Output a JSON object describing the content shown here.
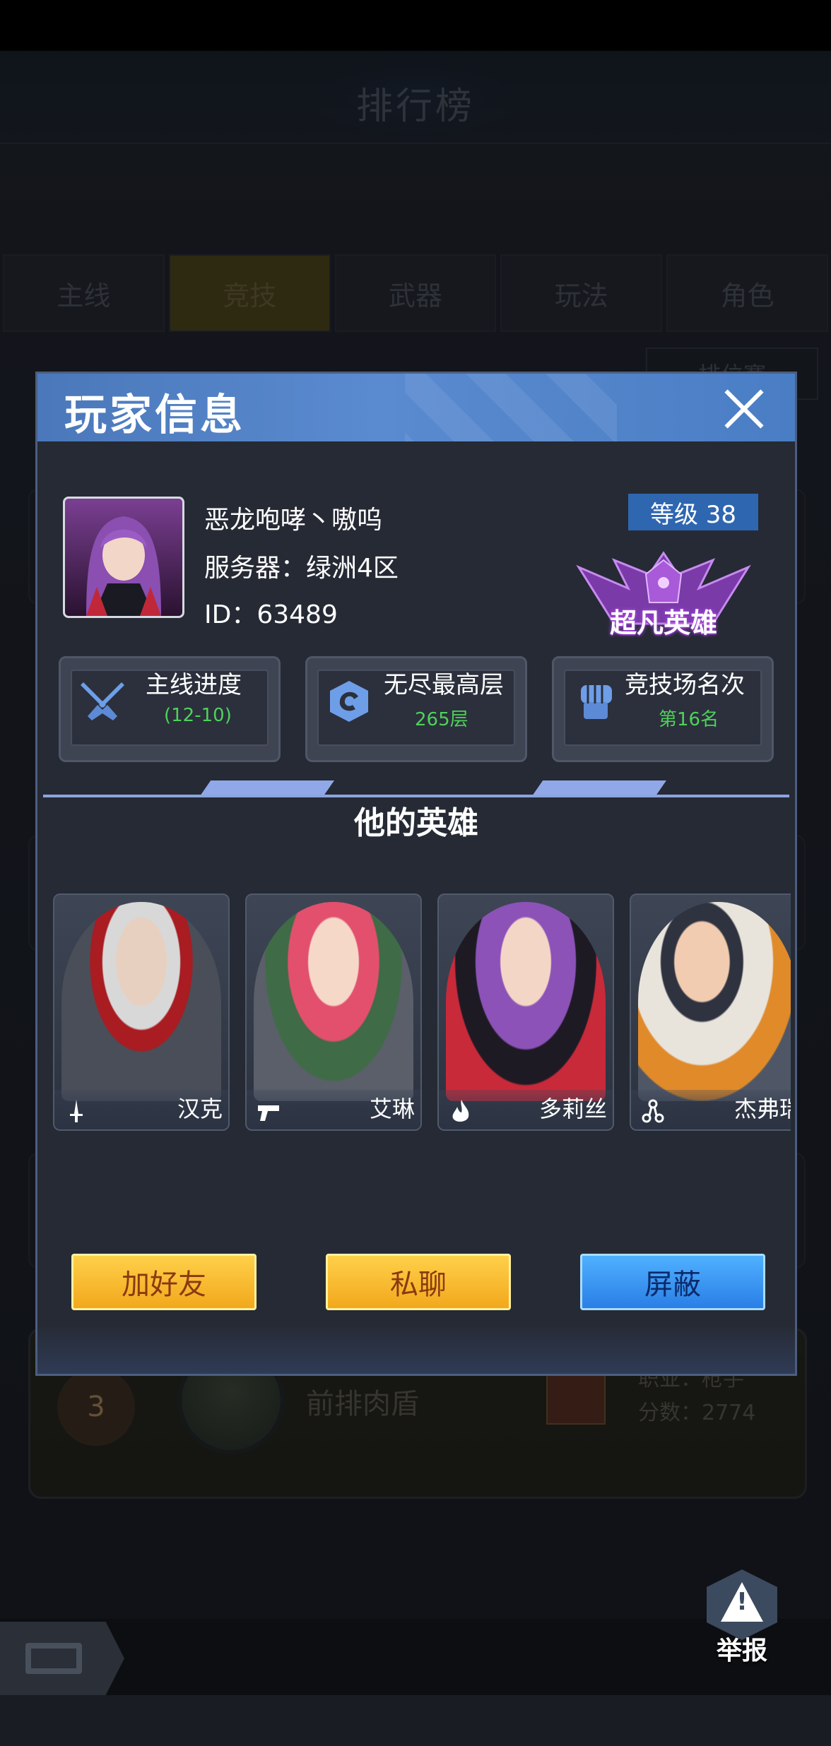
{
  "background": {
    "title": "排行榜",
    "tabs": [
      "主线",
      "竞技",
      "武器",
      "玩法",
      "角色"
    ],
    "active_tab": "竞技",
    "sort_label": "排位赛",
    "row3": {
      "rank": "3",
      "name": "前排肉盾",
      "job": "职业：枪手",
      "score": "分数：2774"
    },
    "report_label": "举报"
  },
  "dialog": {
    "title": "玩家信息",
    "player_name": "恶龙咆哮丶嗷呜",
    "server": "服务器：绿洲4区",
    "id": "ID：63489",
    "level": "等级 38",
    "rank_title": "超凡英雄",
    "stats": [
      {
        "label": "主线进度",
        "value": "(12-10)",
        "icon": "crossed-swords-icon"
      },
      {
        "label": "无尽最高层",
        "value": "265层",
        "icon": "spiral-icon"
      },
      {
        "label": "竞技场名次",
        "value": "第16名",
        "icon": "fist-icon"
      }
    ],
    "heroes_title": "他的英雄",
    "heroes": [
      {
        "name": "汉克",
        "class_icon": "sword-icon"
      },
      {
        "name": "艾琳",
        "class_icon": "pistol-icon"
      },
      {
        "name": "多莉丝",
        "class_icon": "flame-icon"
      },
      {
        "name": "杰弗瑞",
        "class_icon": "node-icon"
      }
    ],
    "buttons": {
      "add_friend": "加好友",
      "private_chat": "私聊",
      "block": "屏蔽"
    }
  },
  "colors": {
    "header_blue": "#4a78ba",
    "stat_value_green": "#4fd15a",
    "button_yellow": "#f2a81c",
    "button_blue": "#2a7fe6"
  }
}
